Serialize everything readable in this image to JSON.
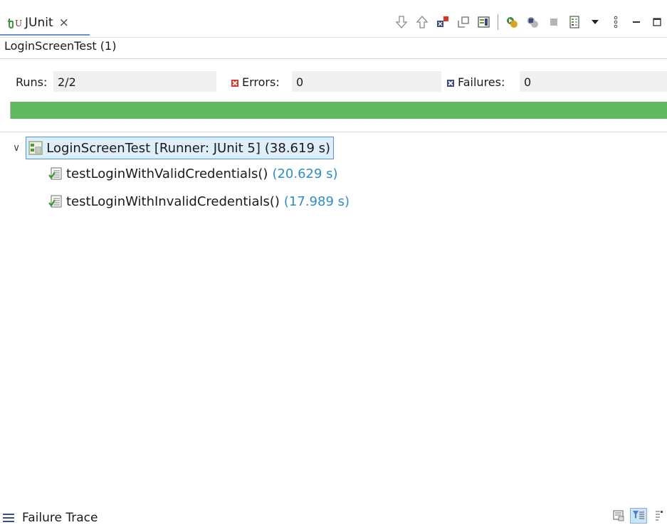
{
  "view": {
    "tab_label": "JUnit",
    "tab_close_glyph": "×",
    "tab_icon": "junit-icon"
  },
  "toolbar": {
    "items": [
      {
        "name": "next-failure-icon"
      },
      {
        "name": "previous-failure-icon"
      },
      {
        "name": "show-failures-only-icon"
      },
      {
        "name": "show-skipped-only-icon"
      },
      {
        "name": "scroll-lock-icon"
      },
      {
        "name": "rerun-test-icon"
      },
      {
        "name": "rerun-failed-first-icon"
      },
      {
        "name": "stop-icon"
      },
      {
        "name": "test-run-history-icon"
      },
      {
        "name": "history-dropdown-icon"
      },
      {
        "name": "view-menu-icon"
      },
      {
        "name": "minimize-icon"
      },
      {
        "name": "maximize-icon"
      }
    ]
  },
  "run": {
    "title": "LoginScreenTest (1)"
  },
  "counters": {
    "runs_label": "Runs:",
    "runs_value": "2/2",
    "errors_label": "Errors:",
    "errors_value": "0",
    "failures_label": "Failures:",
    "failures_value": "0"
  },
  "progress": {
    "fraction": 1.0,
    "color": "#5fba5f"
  },
  "tree": {
    "suite": {
      "label": "LoginScreenTest [Runner: JUnit 5]",
      "duration": "(38.619 s)",
      "expanded": true
    },
    "tests": [
      {
        "label": "testLoginWithValidCredentials()",
        "duration": "(20.629 s)"
      },
      {
        "label": "testLoginWithInvalidCredentials()",
        "duration": "(17.989 s)"
      }
    ]
  },
  "failure_trace": {
    "label": "Failure Trace"
  },
  "colors": {
    "accent": "#4f94d6",
    "duration_blue": "#2f8dc6",
    "error_red": "#d9362b",
    "failure_navy": "#3c4a7a"
  }
}
